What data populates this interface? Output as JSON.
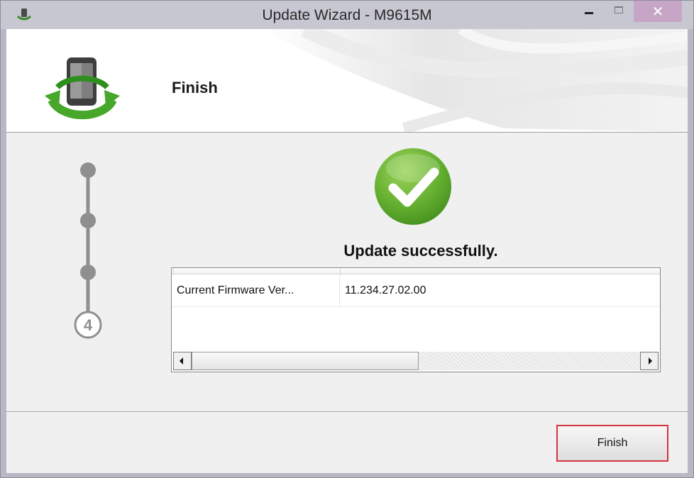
{
  "window": {
    "title": "Update Wizard - M9615M",
    "controls": {
      "minimize_icon": "minimize-icon",
      "maximize_icon": "maximize-icon",
      "close_glyph": "✕"
    }
  },
  "header": {
    "title": "Finish",
    "icon": "phone-sync-icon"
  },
  "steps": {
    "current_step": "4",
    "total_steps": 4
  },
  "result": {
    "icon": "success-check-icon",
    "message": "Update successfully."
  },
  "firmware_list": {
    "rows": [
      {
        "name": "Current Firmware Ver...",
        "value": "11.234.27.02.00"
      }
    ]
  },
  "footer": {
    "finish_label": "Finish"
  },
  "colors": {
    "titlebar": "#c7c7d2",
    "close_button": "#c7a5c6",
    "success_green": "#6bb33a",
    "finish_border": "#d4333f",
    "step_gray": "#8f8f8f"
  }
}
